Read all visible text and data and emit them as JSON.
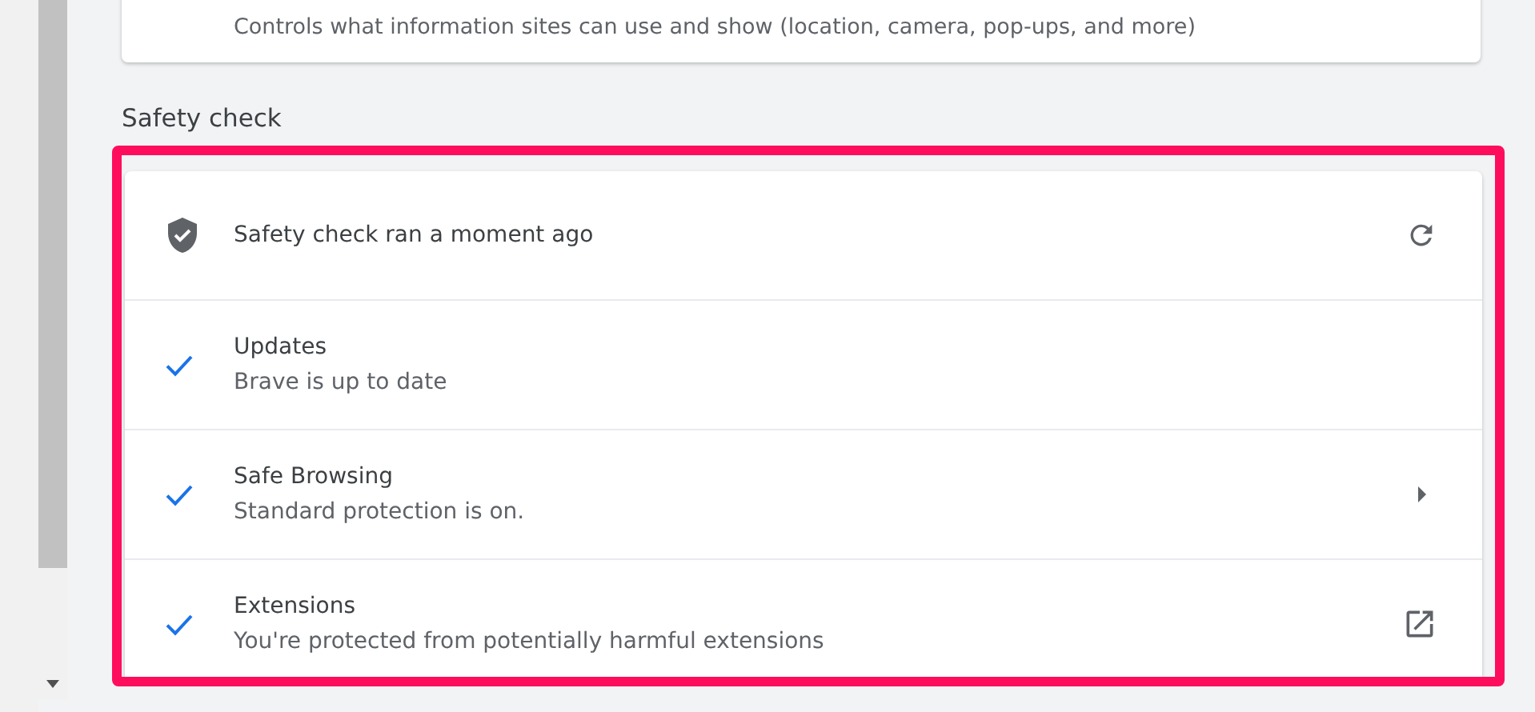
{
  "previous_card": {
    "description": "Controls what information sites can use and show (location, camera, pop-ups, and more)"
  },
  "section_title": "Safety check",
  "safety_rows": [
    {
      "kind": "header",
      "title": "Safety check ran a moment ago",
      "action": {
        "kind": "refresh"
      }
    },
    {
      "kind": "item",
      "title": "Updates",
      "subtitle": "Brave is up to date"
    },
    {
      "kind": "item",
      "title": "Safe Browsing",
      "subtitle": "Standard protection is on.",
      "action": {
        "kind": "arrow"
      }
    },
    {
      "kind": "item",
      "title": "Extensions",
      "subtitle": "You're protected from potentially harmful extensions",
      "action": {
        "kind": "external"
      }
    }
  ]
}
